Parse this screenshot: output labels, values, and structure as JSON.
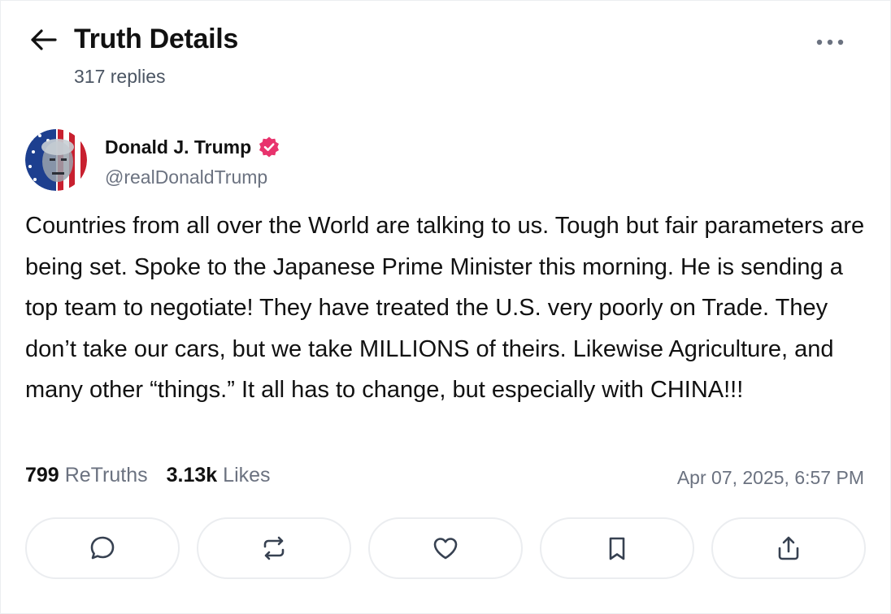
{
  "header": {
    "title": "Truth Details",
    "reply_count": "317 replies",
    "back_icon": "arrow-left-icon",
    "more_icon": "more-horizontal-icon"
  },
  "post": {
    "author": {
      "name": "Donald J. Trump",
      "handle": "@realDonaldTrump",
      "verified": true,
      "verified_color": "#e8336d"
    },
    "text": "Countries from all over the World are talking to us. Tough but fair parameters are being set. Spoke to the Japanese Prime Minister this morning. He is sending a top team to negotiate! They have treated the U.S. very poorly on Trade. They don’t take our cars, but we take MILLIONS of theirs. Likewise Agriculture, and many other “things.” It all has to change, but especially with CHINA!!!",
    "stats": {
      "retruths_count": "799",
      "retruths_label": "ReTruths",
      "likes_count": "3.13k",
      "likes_label": "Likes"
    },
    "timestamp": "Apr 07, 2025, 6:57 PM"
  },
  "actions": [
    {
      "name": "reply",
      "icon": "comment-icon"
    },
    {
      "name": "retruth",
      "icon": "repost-icon"
    },
    {
      "name": "like",
      "icon": "heart-icon"
    },
    {
      "name": "bookmark",
      "icon": "bookmark-icon"
    },
    {
      "name": "share",
      "icon": "share-icon"
    }
  ],
  "colors": {
    "text_primary": "#111111",
    "text_secondary": "#6b7280",
    "border": "#ebedf0",
    "icon": "#374151"
  }
}
